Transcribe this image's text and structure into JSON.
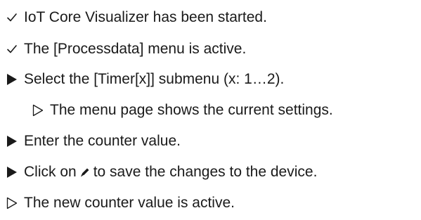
{
  "steps": [
    {
      "type": "precondition",
      "marker_icon": "check-icon",
      "text": "IoT Core Visualizer has been started."
    },
    {
      "type": "precondition",
      "marker_icon": "check-icon",
      "text": "The [Processdata] menu is active."
    },
    {
      "type": "action",
      "marker_icon": "filled-triangle-icon",
      "text": "Select the [Timer[x]] submenu (x: 1…2)."
    },
    {
      "type": "result",
      "marker_icon": "outline-triangle-icon",
      "text": "The menu page shows the current settings."
    },
    {
      "type": "action",
      "marker_icon": "filled-triangle-icon",
      "text": "Enter the counter value."
    },
    {
      "type": "action",
      "marker_icon": "filled-triangle-icon",
      "text_before": "Click on",
      "inline_icon": "pencil-icon",
      "text_after": "to save the changes to the device."
    },
    {
      "type": "result",
      "marker_icon": "outline-triangle-icon",
      "text": "The new counter value is active."
    }
  ]
}
